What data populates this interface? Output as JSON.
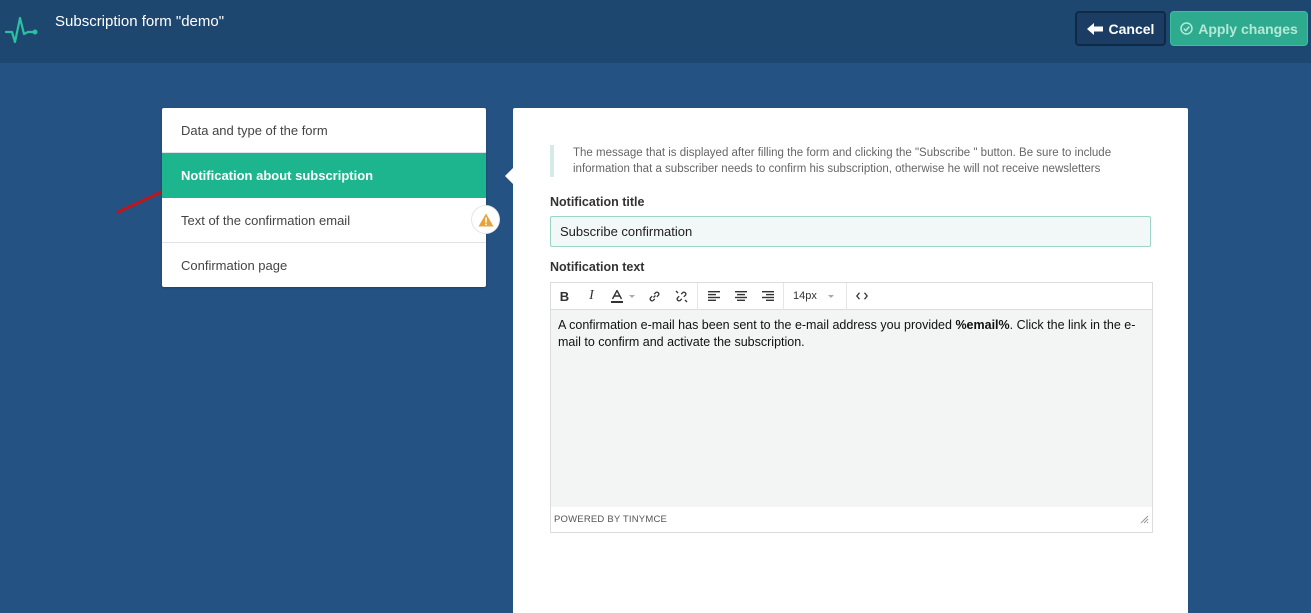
{
  "header": {
    "title": "Subscription form \"demo\"",
    "cancel_label": "Cancel",
    "apply_label": "Apply changes"
  },
  "menu": {
    "items": [
      {
        "label": "Data and type of the form"
      },
      {
        "label": "Notification about subscription"
      },
      {
        "label": "Text of the confirmation email"
      },
      {
        "label": "Confirmation page"
      }
    ]
  },
  "panel": {
    "hint": "The message that is displayed after filling the form and clicking the \"Subscribe \" button. Be sure to include information that a subscriber needs to confirm his subscription, otherwise he will not receive newsletters",
    "title_label": "Notification title",
    "title_value": "Subscribe confirmation",
    "text_label": "Notification text",
    "editor": {
      "font_size": "14px",
      "body_part1": "A confirmation e-mail has been sent to the e-mail address you provided ",
      "body_bold": "%email%",
      "body_part2": ". Click the link in the e-mail to confirm and activate the subscription.",
      "powered_by": "POWERED BY TINYMCE"
    }
  },
  "colors": {
    "background": "#245283",
    "header": "#1e4770",
    "accent": "#1cb58d",
    "warning": "#e8a33a",
    "annotation": "#c0161a"
  }
}
